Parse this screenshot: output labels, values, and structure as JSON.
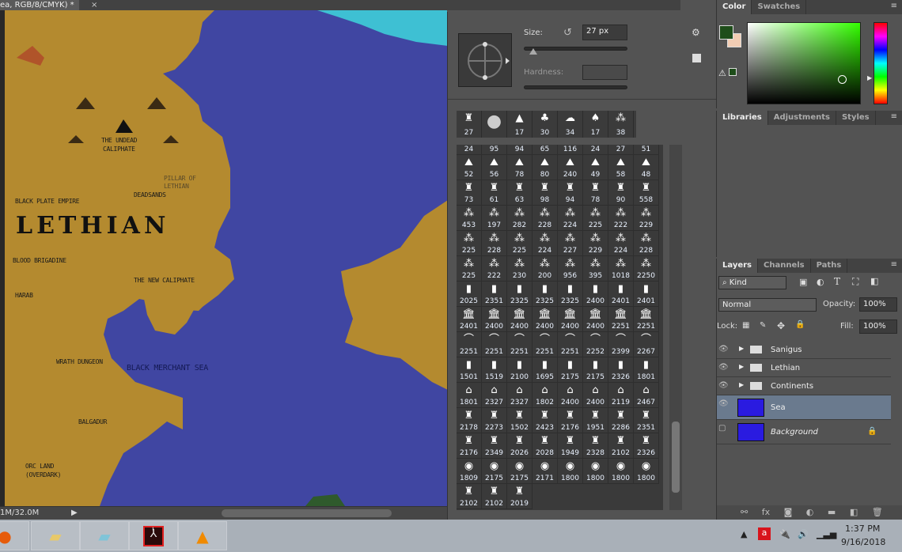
{
  "document": {
    "tab_title": "ea, RGB/8/CMYK) *",
    "close": "×",
    "status": "1M/32.0M",
    "status_arrow": "▶"
  },
  "map": {
    "colors": {
      "sea": "#4046a2",
      "land": "#b48a2f",
      "shallow": "#3ec0d3"
    },
    "title": "LETHIAN",
    "labels": [
      "THE UNDEAD",
      "CALIPHATE",
      "PILLAR OF",
      "LETHIAN",
      "DEADSANDS",
      "BLACK PLATE EMPIRE",
      "BLOOD BRIGADINE",
      "THE NEW CALIPHATE",
      "HARAB",
      "WRATH DUNGEON",
      "BLACK MERCHANT SEA",
      "BALGADUR",
      "ORC LAND",
      "(OVERDARK)"
    ]
  },
  "brush": {
    "size_label": "Size:",
    "size_value": "27 px",
    "size_percent": 9,
    "hardness_label": "Hardness:",
    "gear": "⚙",
    "reset_icon": "↺",
    "presets": [
      {
        "n": "27",
        "g": "♜"
      },
      {
        "n": "",
        "g": "●"
      },
      {
        "n": "17",
        "g": "▲"
      },
      {
        "n": "30",
        "g": "♣"
      },
      {
        "n": "34",
        "g": "☁"
      },
      {
        "n": "17",
        "g": "♠"
      },
      {
        "n": "38",
        "g": "⁂"
      }
    ],
    "rows": [
      {
        "g": "⛰",
        "n": [
          "24",
          "95",
          "94",
          "65",
          "116",
          "24",
          "27",
          "51"
        ]
      },
      {
        "g": "⛰",
        "n": [
          "52",
          "56",
          "78",
          "80",
          "240",
          "49",
          "58",
          "48"
        ]
      },
      {
        "g": "♜",
        "n": [
          "73",
          "61",
          "63",
          "98",
          "94",
          "78",
          "90",
          "558"
        ]
      },
      {
        "g": "⁂",
        "n": [
          "453",
          "197",
          "282",
          "228",
          "224",
          "225",
          "222",
          "229"
        ]
      },
      {
        "g": "⁂",
        "n": [
          "225",
          "228",
          "225",
          "224",
          "227",
          "229",
          "224",
          "228"
        ]
      },
      {
        "g": "⁂",
        "n": [
          "225",
          "222",
          "230",
          "200",
          "956",
          "395",
          "1018",
          "2250"
        ]
      },
      {
        "g": "▮",
        "n": [
          "2025",
          "2351",
          "2325",
          "2325",
          "2325",
          "2400",
          "2401",
          "2401"
        ]
      },
      {
        "g": "🏛",
        "n": [
          "2401",
          "2400",
          "2400",
          "2400",
          "2400",
          "2400",
          "2251",
          "2251"
        ]
      },
      {
        "g": "⌒",
        "n": [
          "2251",
          "2251",
          "2251",
          "2251",
          "2251",
          "2252",
          "2399",
          "2267"
        ]
      },
      {
        "g": "▮",
        "n": [
          "1501",
          "1519",
          "2100",
          "1695",
          "2175",
          "2175",
          "2326",
          "1801"
        ]
      },
      {
        "g": "⌂",
        "n": [
          "1801",
          "2327",
          "2327",
          "1802",
          "2400",
          "2400",
          "2119",
          "2467"
        ]
      },
      {
        "g": "♜",
        "n": [
          "2178",
          "2273",
          "1502",
          "2423",
          "2176",
          "1951",
          "2286",
          "2351"
        ]
      },
      {
        "g": "♜",
        "n": [
          "2176",
          "2349",
          "2026",
          "2028",
          "1949",
          "2328",
          "2102",
          "2326"
        ]
      },
      {
        "g": "◉",
        "n": [
          "1809",
          "2175",
          "2175",
          "2171",
          "1800",
          "1800",
          "1800",
          "1800"
        ]
      },
      {
        "g": "♜",
        "n": [
          "2102",
          "2102",
          "2019"
        ]
      }
    ]
  },
  "color_panel": {
    "tabs": [
      "Color",
      "Swatches"
    ],
    "fg": "#1e4d1a",
    "bg": "#f2cdb4",
    "picked": "#1e3a1e",
    "hue": "#33ff00"
  },
  "libraries_panel": {
    "tabs": [
      "Libraries",
      "Adjustments",
      "Styles"
    ]
  },
  "layers_panel": {
    "tabs": [
      "Layers",
      "Channels",
      "Paths"
    ],
    "filter": "Kind",
    "blend_mode": "Normal",
    "opacity_label": "Opacity:",
    "opacity": "100%",
    "lock_label": "Lock:",
    "fill_label": "Fill:",
    "fill": "100%",
    "layers": [
      {
        "name": "Sanigus",
        "type": "group",
        "visible": true
      },
      {
        "name": "Lethian",
        "type": "group",
        "visible": true
      },
      {
        "name": "Continents",
        "type": "group",
        "visible": true
      },
      {
        "name": "Sea",
        "type": "layer",
        "visible": true,
        "selected": true,
        "thumb": "#2a1be0"
      },
      {
        "name": "Background",
        "type": "background",
        "visible": false,
        "locked": true,
        "thumb": "#2a1be0"
      }
    ]
  },
  "taskbar": {
    "apps": [
      "firefox",
      "file-explorer",
      "notepad",
      "acrobat-reader",
      "vlc"
    ],
    "time": "1:37 PM",
    "date": "9/16/2018"
  }
}
